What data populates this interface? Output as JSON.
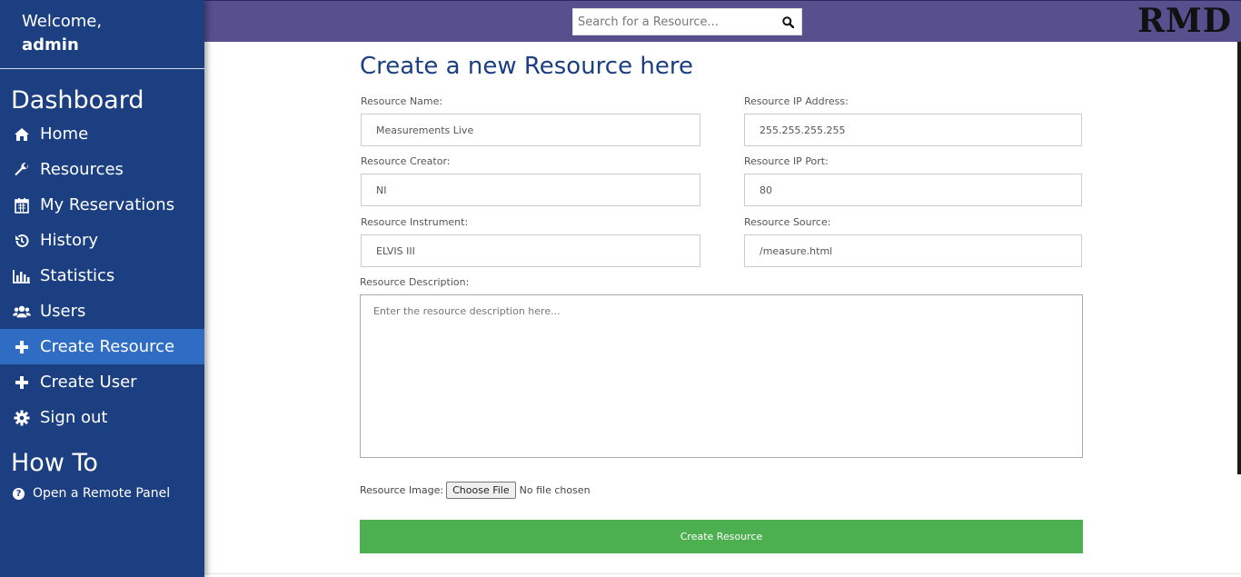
{
  "sidebar": {
    "welcome_label": "Welcome,",
    "username": "admin",
    "dashboard_title": "Dashboard",
    "items": [
      {
        "label": "Home",
        "icon": "home-icon"
      },
      {
        "label": "Resources",
        "icon": "wrench-icon"
      },
      {
        "label": "My Reservations",
        "icon": "calendar-icon"
      },
      {
        "label": "History",
        "icon": "history-icon"
      },
      {
        "label": "Statistics",
        "icon": "bar-chart-icon"
      },
      {
        "label": "Users",
        "icon": "users-icon"
      },
      {
        "label": "Create Resource",
        "icon": "plus-icon",
        "active": true
      },
      {
        "label": "Create User",
        "icon": "plus-icon"
      },
      {
        "label": "Sign out",
        "icon": "gear-icon"
      }
    ],
    "howto_title": "How To",
    "howto_items": [
      {
        "label": "Open a Remote Panel",
        "icon": "question-circle-icon"
      }
    ]
  },
  "topbar": {
    "search_placeholder": "Search for a Resource...",
    "logo_text": "RMD"
  },
  "form": {
    "title": "Create a new Resource here",
    "name": {
      "label": "Resource Name:",
      "value": "Measurements Live"
    },
    "ip_address": {
      "label": "Resource IP Address:",
      "value": "255.255.255.255"
    },
    "creator": {
      "label": "Resource Creator:",
      "value": "NI"
    },
    "ip_port": {
      "label": "Resource IP Port:",
      "value": "80"
    },
    "instrument": {
      "label": "Resource Instrument:",
      "value": "ELVIS III"
    },
    "source": {
      "label": "Resource Source:",
      "value": "/measure.html"
    },
    "description": {
      "label": "Resource Description:",
      "placeholder": "Enter the resource description here..."
    },
    "image": {
      "label": "Resource Image:",
      "button": "Choose File",
      "status": "No file chosen"
    },
    "submit_label": "Create Resource"
  },
  "colors": {
    "sidebar_bg": "#1b3f80",
    "sidebar_active": "#2f6dc5",
    "topbar_bg": "#56508f",
    "title_color": "#1b3f80",
    "submit_bg": "#4caf50"
  }
}
